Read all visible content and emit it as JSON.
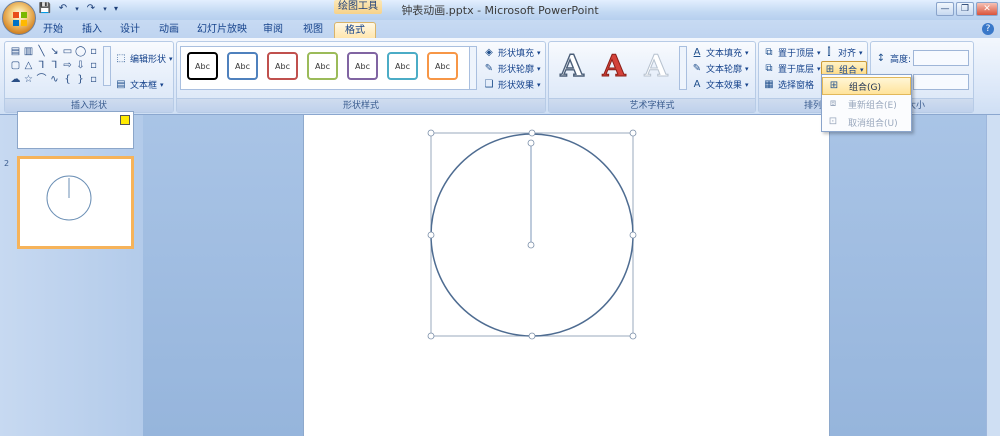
{
  "window": {
    "title": "钟表动画.pptx - Microsoft PowerPoint",
    "context_tab": "绘图工具"
  },
  "tabs": [
    "开始",
    "插入",
    "设计",
    "动画",
    "幻灯片放映",
    "审阅",
    "视图",
    "格式"
  ],
  "active_tab": "格式",
  "groups": {
    "insert_shapes": {
      "title": "插入形状",
      "edit_shape": "编辑形状",
      "text_box": "文本框"
    },
    "shape_styles": {
      "title": "形状样式",
      "style_label": "Abc",
      "style_colors": [
        "#000000",
        "#4f81bd",
        "#c0504d",
        "#9bbb59",
        "#8064a2",
        "#4bacc6",
        "#f79646"
      ],
      "fill": "形状填充",
      "outline": "形状轮廓",
      "effect": "形状效果"
    },
    "wordart": {
      "title": "艺术字样式",
      "text_fill": "文本填充",
      "text_outline": "文本轮廓",
      "text_effect": "文本效果"
    },
    "arrange": {
      "title": "排列",
      "bring_front": "置于顶层",
      "send_back": "置于底层",
      "selection_pane": "选择窗格",
      "align": "对齐",
      "group": "组合"
    },
    "size": {
      "title": "大小",
      "height_label": "高度:"
    }
  },
  "group_menu": [
    {
      "label": "组合(G)",
      "state": "highlighted"
    },
    {
      "label": "重新组合(E)",
      "state": "disabled"
    },
    {
      "label": "取消组合(U)",
      "state": "disabled"
    }
  ],
  "thumbnails": [
    {
      "number": ""
    },
    {
      "number": "2"
    }
  ]
}
